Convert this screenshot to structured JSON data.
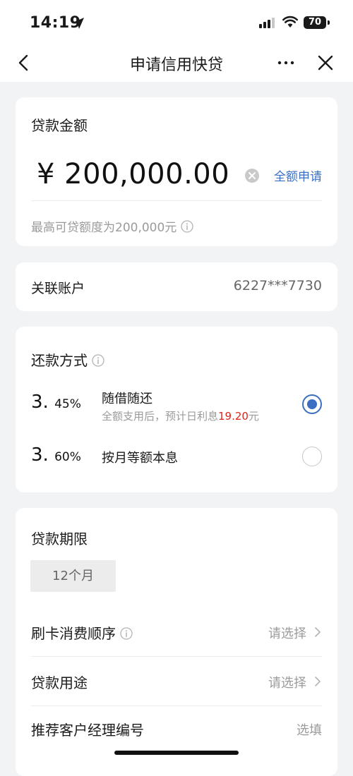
{
  "status_bar": {
    "time": "14:19",
    "battery": "70"
  },
  "nav": {
    "title": "申请信用快贷"
  },
  "amount_card": {
    "title": "贷款金额",
    "amount": "¥ 200,000.00",
    "full_apply": "全额申请",
    "hint": "最高可贷额度为200,000元"
  },
  "account_card": {
    "label": "关联账户",
    "value": "6227***7730"
  },
  "repay_card": {
    "title": "还款方式",
    "options": [
      {
        "rate_int": "3.",
        "rate_dec": "45%",
        "title": "随借随还",
        "sub_prefix": "全额支用后，预计日利息",
        "sub_amount": "19.20",
        "sub_suffix": "元",
        "selected": true
      },
      {
        "rate_int": "3.",
        "rate_dec": "60%",
        "title": "按月等额本息",
        "selected": false
      }
    ]
  },
  "term_card": {
    "title": "贷款期限",
    "term": "12个月",
    "rows": [
      {
        "label": "刷卡消费顺序",
        "value": "请选择"
      },
      {
        "label": "贷款用途",
        "value": "请选择"
      },
      {
        "label": "推荐客户经理编号",
        "value": "选填"
      }
    ]
  },
  "colors": {
    "accent": "#3a6fc2",
    "red": "#e0241b",
    "bg": "#f2f3f5"
  }
}
